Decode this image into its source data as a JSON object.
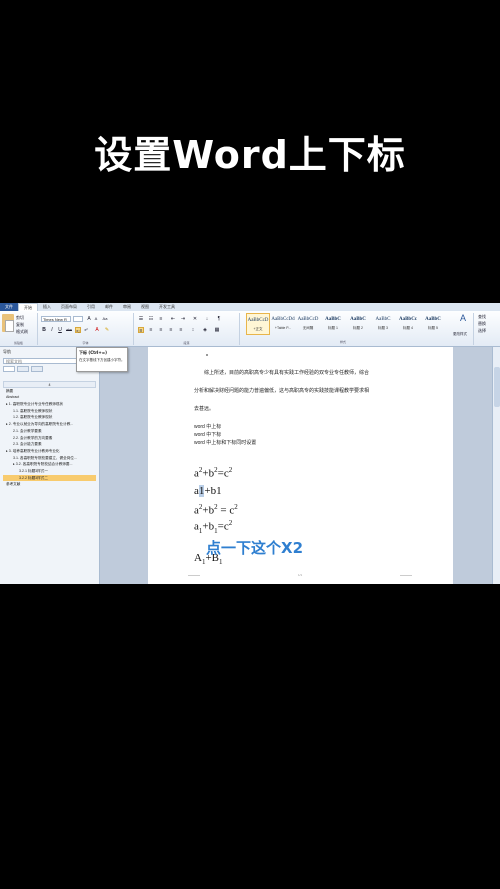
{
  "title": "设置Word上下标",
  "menu": [
    "文件",
    "开始",
    "插入",
    "页面布局",
    "引用",
    "邮件",
    "审阅",
    "视图",
    "开发工具"
  ],
  "ribbon": {
    "clipboard": {
      "cut": "剪切",
      "copy": "复制",
      "format_painter": "格式刷",
      "label": "剪贴板"
    },
    "font": {
      "font_name": "Times New R",
      "bold": "B",
      "italic": "I",
      "underline": "U",
      "strike": "abe",
      "subscript": "x₂",
      "superscript": "x²",
      "grow": "A",
      "shrink": "A",
      "clear": "Aa",
      "label": "字体"
    },
    "paragraph": {
      "label": "段落"
    },
    "styles": {
      "items": [
        {
          "preview": "AaBbCcD",
          "name": "+正文"
        },
        {
          "preview": "AaBbCcDd",
          "name": "+Table P..."
        },
        {
          "preview": "AaBbCcD",
          "name": "无间隔"
        },
        {
          "preview": "AaBbC",
          "name": "标题 1"
        },
        {
          "preview": "AaBbC",
          "name": "标题 2"
        },
        {
          "preview": "AaBbC",
          "name": "标题 3"
        },
        {
          "preview": "AaBbCc",
          "name": "标题 4"
        },
        {
          "preview": "AaBbC",
          "name": "标题 5"
        }
      ],
      "change_styles": "更改样式",
      "label": "样式"
    },
    "editing": {
      "find": "查找",
      "replace": "替换",
      "select": "选择"
    }
  },
  "tooltip": {
    "title": "下标 (Ctrl+=)",
    "desc": "在文字基线下方创建小字符。"
  },
  "nav": {
    "title": "导航",
    "search_placeholder": "搜索文档",
    "items": [
      {
        "text": "4",
        "level": "num"
      },
      {
        "text": "摘要",
        "level": "l1"
      },
      {
        "text": "Abstract",
        "level": "l1"
      },
      {
        "text": "▸ 1. 高职院专业计专业专任教师现状",
        "level": "l1"
      },
      {
        "text": "1.1. 高职院专业教师现状",
        "level": "l2"
      },
      {
        "text": "1.2. 高职院专业教师现状",
        "level": "l2"
      },
      {
        "text": "▸ 2. 专业以就业为导向的高职院专业计教...",
        "level": "l1"
      },
      {
        "text": "2.1. 会计教学要素",
        "level": "l2"
      },
      {
        "text": "2.2. 会计教学的方向要素",
        "level": "l2"
      },
      {
        "text": "2.3. 会计能力要素",
        "level": "l2"
      },
      {
        "text": "▸ 3. 培养高职院专业计教师专业化",
        "level": "l1"
      },
      {
        "text": "3.1. 各高职院专院校要建立、健全岗位...",
        "level": "l2"
      },
      {
        "text": "▸ 3.2. 各高职院专院校结合计教师要...",
        "level": "l2"
      },
      {
        "text": "3.2.1 标题3样式一",
        "level": "l3"
      },
      {
        "text": "3.2.2 标题3样式二",
        "level": "l3",
        "selected": true
      },
      {
        "text": "参考文献",
        "level": "l1"
      }
    ]
  },
  "document": {
    "para1": "综上所述，目前的高职高专少有具有实践工作经验的双专业专任教师，综合",
    "para2": "分析和解决财经问题的能力普遍偏低，这与高职高专的实践技能课程教学要求相",
    "para3": "去甚远。",
    "line_super": "word 中上标",
    "line_sub": "word 中下标",
    "line_both": "word 中上标和下标同时设置",
    "f1": {
      "a": "a",
      "b": "b",
      "c": "c",
      "exp": "2",
      "plus": "+",
      "eq": "="
    },
    "f2": {
      "text_a": "a",
      "text_sel": "1",
      "text_rest": "+b1"
    },
    "f3": {
      "a": "a",
      "b": "b",
      "c": "c",
      "exp": "2",
      "plus": "+",
      "eq": " = "
    },
    "f4": {
      "a": "a",
      "b": "b",
      "c": "c",
      "sub": "1",
      "exp": "2",
      "plus": "+",
      "eq": "="
    },
    "f5": {
      "A": "A",
      "B": "B",
      "sub1": "1",
      "plus": "+",
      "sub2": "1"
    },
    "caption": "点一下这个X2",
    "page_number": "1/1"
  }
}
